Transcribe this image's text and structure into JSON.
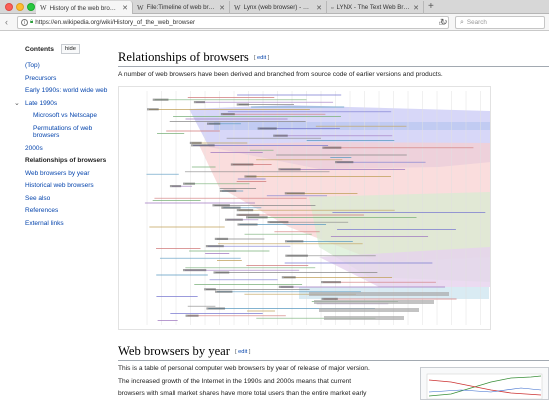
{
  "browser": {
    "tabs": [
      {
        "title": "History of the web browser",
        "active": true
      },
      {
        "title": "File:Timeline of web browsers",
        "active": false
      },
      {
        "title": "Lynx (web browser) - Wikipe",
        "active": false
      },
      {
        "title": "LYNX - The Text Web Browser",
        "active": false
      }
    ],
    "url": "https://en.wikipedia.org/wiki/History_of_the_web_browser",
    "search_placeholder": "Search"
  },
  "toc": {
    "title": "Contents",
    "hide_label": "hide",
    "items": [
      {
        "label": "(Top)",
        "level": 1
      },
      {
        "label": "Precursors",
        "level": 1
      },
      {
        "label": "Early 1990s: world wide web",
        "level": 1
      },
      {
        "label": "Late 1990s",
        "level": 1
      },
      {
        "label": "Microsoft vs Netscape",
        "level": 2
      },
      {
        "label": "Permutations of web browsers",
        "level": 2
      },
      {
        "label": "2000s",
        "level": 1
      },
      {
        "label": "Relationships of browsers",
        "level": 1,
        "current": true
      },
      {
        "label": "Web browsers by year",
        "level": 1
      },
      {
        "label": "Historical web browsers",
        "level": 1
      },
      {
        "label": "See also",
        "level": 1
      },
      {
        "label": "References",
        "level": 1
      },
      {
        "label": "External links",
        "level": 1
      }
    ]
  },
  "sections": {
    "relationships": {
      "heading": "Relationships of browsers",
      "edit_label": "edit",
      "text": "A number of web browsers have been derived and branched from source code of earlier versions and products."
    },
    "by_year": {
      "heading": "Web browsers by year",
      "edit_label": "edit",
      "lines": [
        "This is a table of personal computer web browsers by year of release of major version.",
        "The increased growth of the Internet in the 1990s and 2000s means that current",
        "browsers with small market shares have more total users than the entire market early"
      ]
    }
  },
  "colors": {
    "link": "#0645ad",
    "band_blue": "#c9c9f5",
    "band_red": "#f8cfcf",
    "band_green": "#d6ecd2",
    "band_purple": "#e6d2ee"
  }
}
